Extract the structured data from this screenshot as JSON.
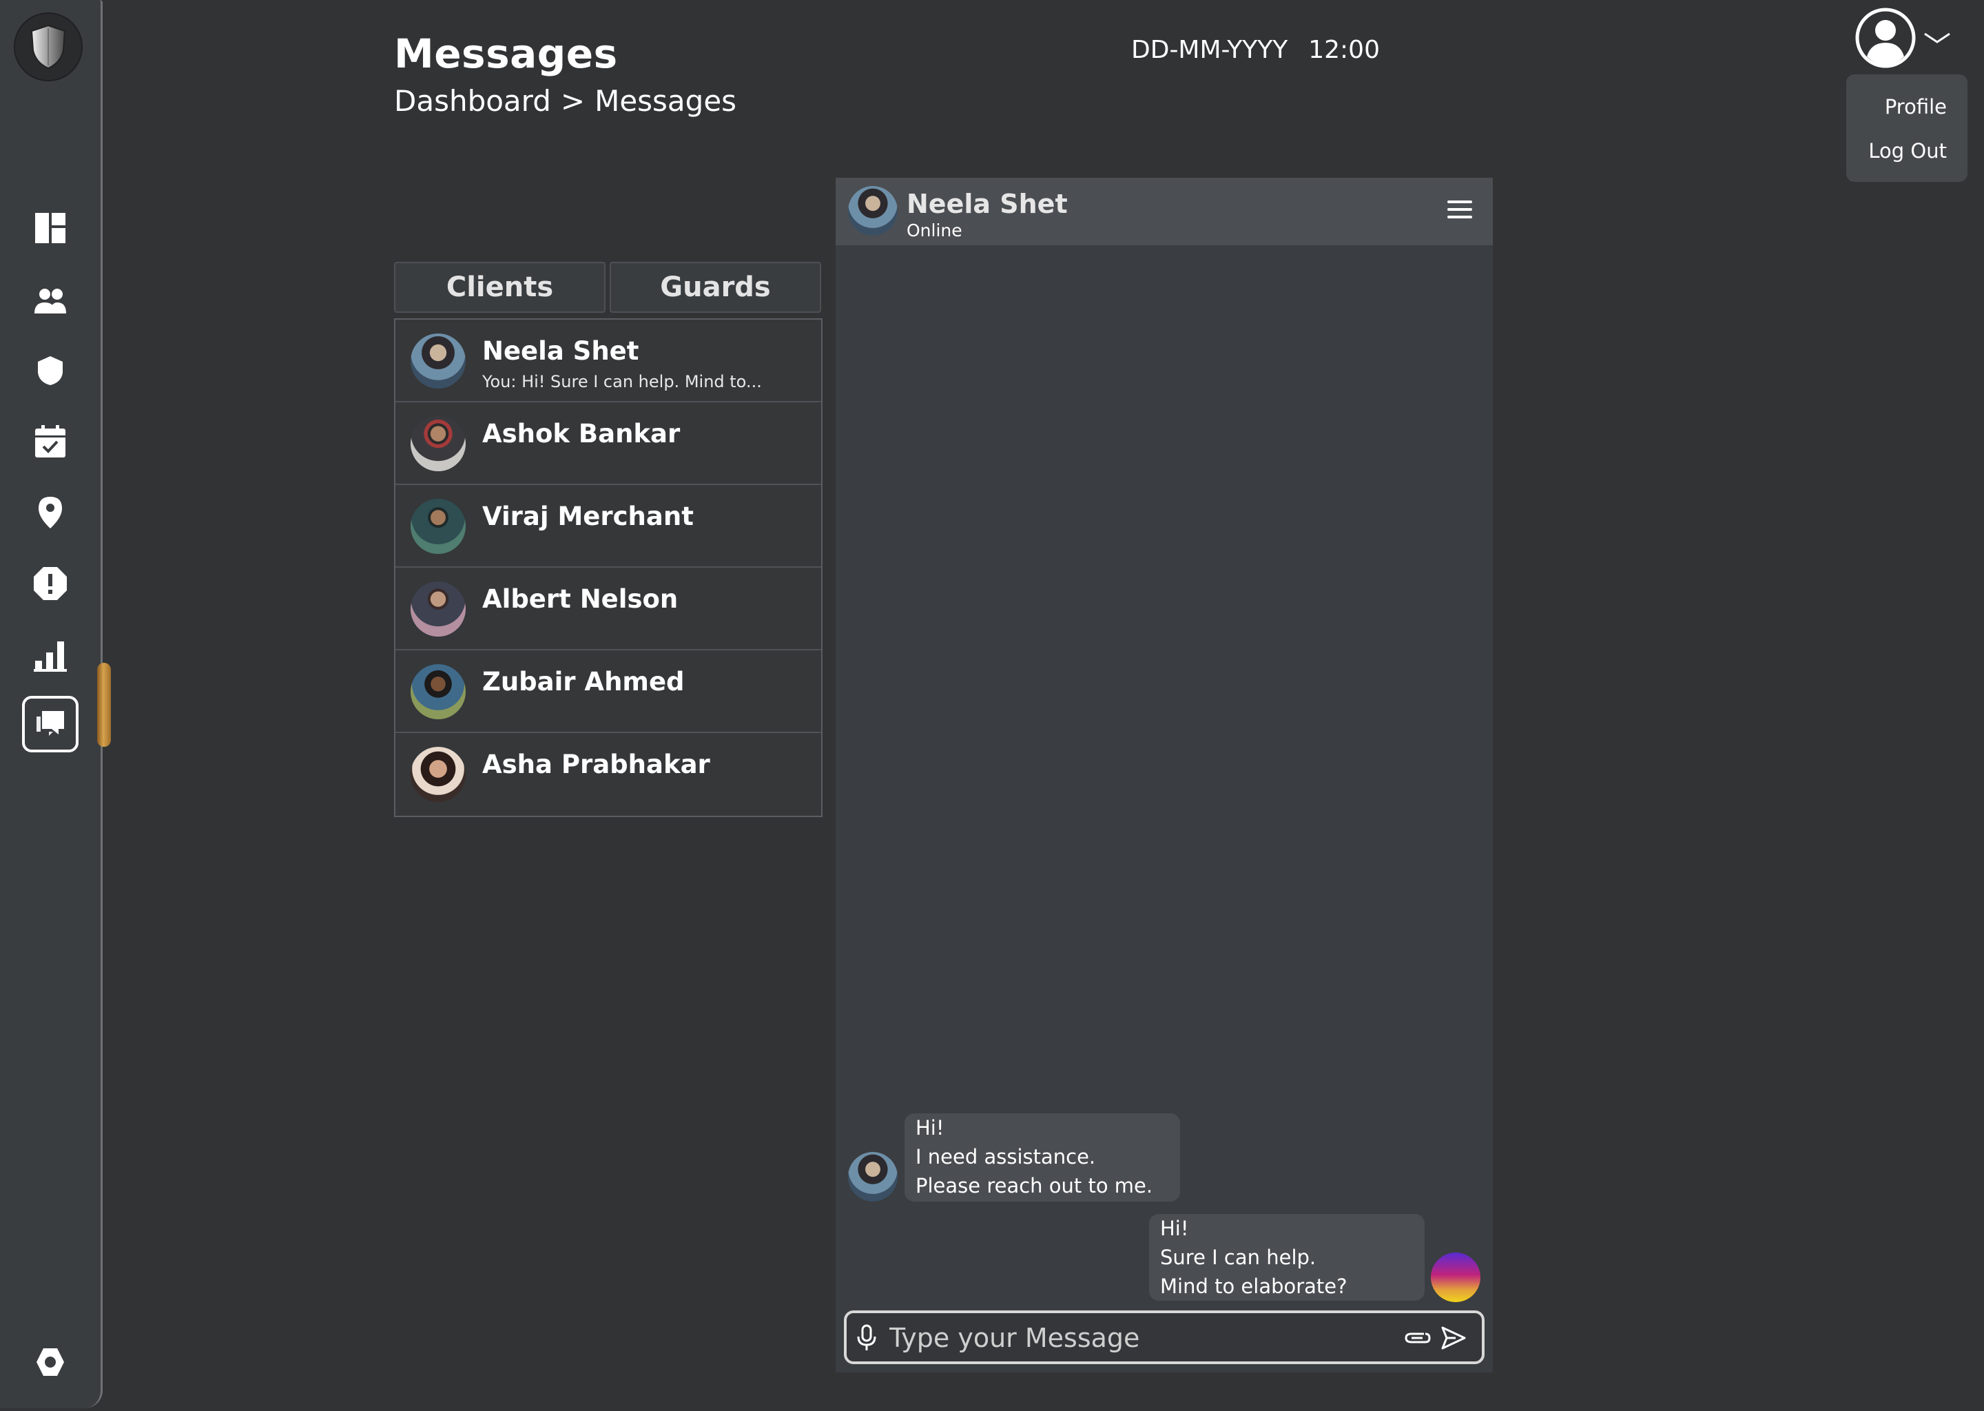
{
  "header": {
    "title": "Messages",
    "breadcrumb": [
      "Dashboard",
      ">",
      "Messages"
    ],
    "date": "DD-MM-YYYY",
    "time": "12:00"
  },
  "profile_menu": {
    "items": [
      "Profile",
      "Log Out"
    ]
  },
  "sidebar": {
    "items": [
      "dashboard-icon",
      "users-icon",
      "shield-icon",
      "calendar-check-icon",
      "location-pin-icon",
      "alert-icon",
      "bar-chart-icon",
      "messages-icon"
    ],
    "active": "messages-icon",
    "footer_icon": "settings-icon"
  },
  "tabs": [
    "Clients",
    "Guards"
  ],
  "contacts": [
    {
      "name": "Neela Shet",
      "preview": "You: Hi! Sure I can help. Mind to..."
    },
    {
      "name": "Ashok Bankar",
      "preview": ""
    },
    {
      "name": "Viraj Merchant",
      "preview": ""
    },
    {
      "name": "Albert Nelson",
      "preview": ""
    },
    {
      "name": "Zubair Ahmed",
      "preview": ""
    },
    {
      "name": "Asha Prabhakar",
      "preview": ""
    }
  ],
  "chat": {
    "name": "Neela Shet",
    "status": "Online",
    "messages": [
      {
        "from": "contact",
        "lines": [
          "Hi!",
          "I need assistance.",
          "Please reach out to me."
        ]
      },
      {
        "from": "me",
        "lines": [
          "Hi!",
          "Sure I can help.",
          "Mind to elaborate?"
        ]
      }
    ],
    "input_placeholder": "Type your Message"
  },
  "colors": {
    "background": "#323335",
    "sidebar": "#3a3d40",
    "panel": "#3a3d41",
    "bubble": "#4a4d51",
    "accent_scroll": "#d5a24c"
  }
}
